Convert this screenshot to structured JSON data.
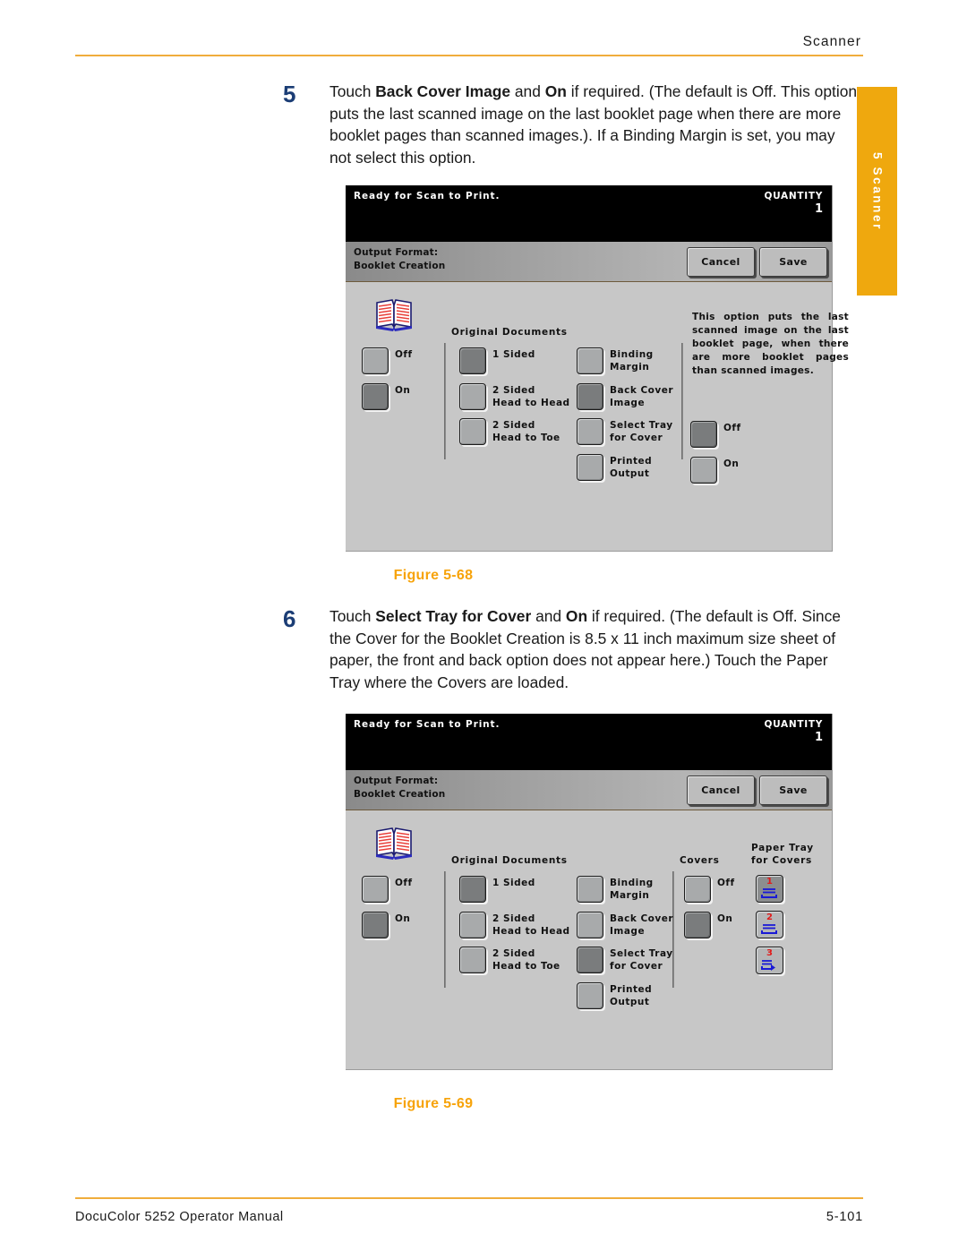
{
  "header": {
    "running_head": "Scanner"
  },
  "side_tab": {
    "label": "5 Scanner",
    "color": "#efa80e"
  },
  "steps": [
    {
      "number": "5",
      "text_html": "Touch <b>Back Cover Image</b> and <b>On</b> if required. (The default is Off. This option puts the last scanned image on the last booklet page when there are more booklet pages than scanned images.). If a Binding Margin is set, you may not select this option."
    },
    {
      "number": "6",
      "text_html": "Touch <b>Select Tray for Cover</b> and <b>On</b> if required. (The default is Off. Since the Cover for the Booklet Creation is 8.5 x 11 inch maximum size sheet of paper, the front and back option does not appear here.) Touch the Paper Tray where the Covers are loaded."
    }
  ],
  "figures": [
    {
      "caption": "Figure 5-68"
    },
    {
      "caption": "Figure 5-69"
    }
  ],
  "panel68": {
    "status_message": "Ready  for  Scan  to  Print.",
    "quantity_label": "QUANTITY",
    "quantity_value": "1",
    "title_line1": "Output Format:",
    "title_line2": "Booklet Creation",
    "cancel_label": "Cancel",
    "save_label": "Save",
    "column_labels": {
      "original_documents": "Original  Documents"
    },
    "booklet_options": [
      {
        "label": "Off",
        "selected": false
      },
      {
        "label": "On",
        "selected": true
      }
    ],
    "original_documents": [
      {
        "label_line1": "1  Sided",
        "label_line2": "",
        "selected": true
      },
      {
        "label_line1": "2  Sided",
        "label_line2": "Head  to  Head",
        "selected": false
      },
      {
        "label_line1": "2  Sided",
        "label_line2": "Head  to  Toe",
        "selected": false
      }
    ],
    "feature_buttons": [
      {
        "label_line1": "Binding",
        "label_line2": "Margin",
        "selected": false
      },
      {
        "label_line1": "Back  Cover",
        "label_line2": "Image",
        "selected": true
      },
      {
        "label_line1": "Select  Tray",
        "label_line2": "for  Cover",
        "selected": false
      },
      {
        "label_line1": "Printed",
        "label_line2": "Output",
        "selected": false
      }
    ],
    "help_text": "This option puts the last scanned image on the last booklet page, when there are more booklet pages than scanned images.",
    "right_options": [
      {
        "label": "Off",
        "selected": true
      },
      {
        "label": "On",
        "selected": false
      }
    ]
  },
  "panel69": {
    "status_message": "Ready  for  Scan  to  Print.",
    "quantity_label": "QUANTITY",
    "quantity_value": "1",
    "title_line1": "Output Format:",
    "title_line2": "Booklet Creation",
    "cancel_label": "Cancel",
    "save_label": "Save",
    "column_labels": {
      "original_documents": "Original  Documents",
      "covers": "Covers",
      "paper_tray_line1": "Paper  Tray",
      "paper_tray_line2": "for  Covers"
    },
    "booklet_options": [
      {
        "label": "Off",
        "selected": false
      },
      {
        "label": "On",
        "selected": true
      }
    ],
    "original_documents": [
      {
        "label_line1": "1  Sided",
        "label_line2": "",
        "selected": true
      },
      {
        "label_line1": "2  Sided",
        "label_line2": "Head  to  Head",
        "selected": false
      },
      {
        "label_line1": "2  Sided",
        "label_line2": "Head  to  Toe",
        "selected": false
      }
    ],
    "feature_buttons": [
      {
        "label_line1": "Binding",
        "label_line2": "Margin",
        "selected": false
      },
      {
        "label_line1": "Back  Cover",
        "label_line2": "Image",
        "selected": false
      },
      {
        "label_line1": "Select  Tray",
        "label_line2": "for  Cover",
        "selected": true
      },
      {
        "label_line1": "Printed",
        "label_line2": "Output",
        "selected": false
      }
    ],
    "covers_options": [
      {
        "label": "Off",
        "selected": false
      },
      {
        "label": "On",
        "selected": true
      }
    ],
    "paper_trays": [
      {
        "number": "1",
        "selected": true,
        "glyph": "tray-stack-icon"
      },
      {
        "number": "2",
        "selected": false,
        "glyph": "tray-stack-icon"
      },
      {
        "number": "3",
        "selected": false,
        "glyph": "tray-arrow-icon"
      }
    ]
  },
  "footer": {
    "manual_title": "DocuColor 5252 Operator Manual",
    "page_number": "5-101"
  }
}
